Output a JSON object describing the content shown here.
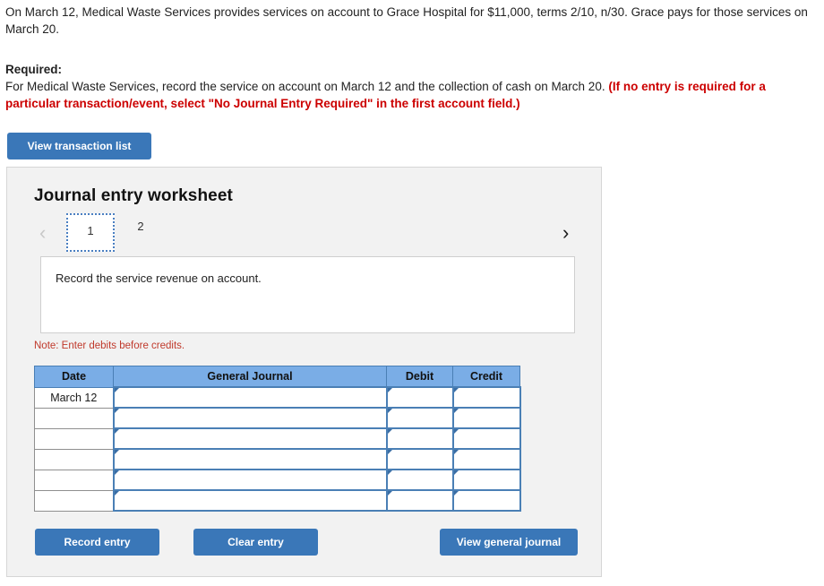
{
  "problem": {
    "statement": "On March 12, Medical Waste Services provides services on account to Grace Hospital for $11,000, terms 2/10, n/30. Grace pays for those services on March 20.",
    "required_label": "Required:",
    "required_text": "For Medical Waste Services, record the service on account on March 12 and the collection of cash on March 20. ",
    "required_note": "(If no entry is required for a particular transaction/event, select \"No Journal Entry Required\" in the first account field.)"
  },
  "toolbar": {
    "view_transaction_list": "View transaction list"
  },
  "worksheet": {
    "title": "Journal entry worksheet",
    "pager": {
      "prev_icon": "chevron-left",
      "next_icon": "chevron-right",
      "tabs": [
        {
          "label": "1",
          "selected": true
        },
        {
          "label": "2",
          "selected": false
        }
      ]
    },
    "description": "Record the service revenue on account.",
    "note": "Note: Enter debits before credits.",
    "table": {
      "headers": [
        "Date",
        "General Journal",
        "Debit",
        "Credit"
      ],
      "rows": [
        {
          "date": "March 12",
          "general_journal": "",
          "debit": "",
          "credit": ""
        },
        {
          "date": "",
          "general_journal": "",
          "debit": "",
          "credit": ""
        },
        {
          "date": "",
          "general_journal": "",
          "debit": "",
          "credit": ""
        },
        {
          "date": "",
          "general_journal": "",
          "debit": "",
          "credit": ""
        },
        {
          "date": "",
          "general_journal": "",
          "debit": "",
          "credit": ""
        },
        {
          "date": "",
          "general_journal": "",
          "debit": "",
          "credit": ""
        }
      ]
    },
    "actions": {
      "record_entry": "Record entry",
      "clear_entry": "Clear entry",
      "view_general_journal": "View general journal"
    }
  },
  "colors": {
    "button_blue": "#3a77b8",
    "header_blue": "#7aade6",
    "cell_border_blue": "#4a7fb5",
    "note_red": "#c0392b",
    "required_red": "#cc0000",
    "panel_bg": "#f2f2f2"
  }
}
